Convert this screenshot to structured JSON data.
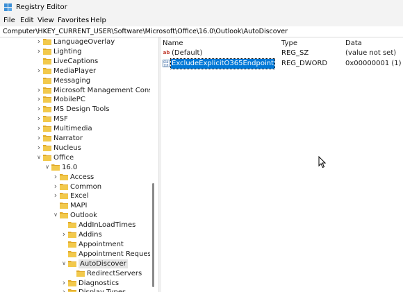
{
  "window": {
    "title": "Registry Editor"
  },
  "menu": {
    "items": [
      "File",
      "Edit",
      "View",
      "Favorites",
      "Help"
    ]
  },
  "address": {
    "path": "Computer\\HKEY_CURRENT_USER\\Software\\Microsoft\\Office\\16.0\\Outlook\\AutoDiscover"
  },
  "tree": {
    "items": [
      {
        "label": "LanguageOverlay",
        "level": 0,
        "expander": "collapsed"
      },
      {
        "label": "Lighting",
        "level": 0,
        "expander": "collapsed"
      },
      {
        "label": "LiveCaptions",
        "level": 0,
        "expander": "none"
      },
      {
        "label": "MediaPlayer",
        "level": 0,
        "expander": "collapsed"
      },
      {
        "label": "Messaging",
        "level": 0,
        "expander": "none"
      },
      {
        "label": "Microsoft Management Console",
        "level": 0,
        "expander": "collapsed"
      },
      {
        "label": "MobilePC",
        "level": 0,
        "expander": "collapsed"
      },
      {
        "label": "MS Design Tools",
        "level": 0,
        "expander": "collapsed"
      },
      {
        "label": "MSF",
        "level": 0,
        "expander": "collapsed"
      },
      {
        "label": "Multimedia",
        "level": 0,
        "expander": "collapsed"
      },
      {
        "label": "Narrator",
        "level": 0,
        "expander": "collapsed"
      },
      {
        "label": "Nucleus",
        "level": 0,
        "expander": "collapsed"
      },
      {
        "label": "Office",
        "level": 0,
        "expander": "expanded"
      },
      {
        "label": "16.0",
        "level": 1,
        "expander": "expanded"
      },
      {
        "label": "Access",
        "level": 2,
        "expander": "collapsed"
      },
      {
        "label": "Common",
        "level": 2,
        "expander": "collapsed"
      },
      {
        "label": "Excel",
        "level": 2,
        "expander": "collapsed"
      },
      {
        "label": "MAPI",
        "level": 2,
        "expander": "none"
      },
      {
        "label": "Outlook",
        "level": 2,
        "expander": "expanded"
      },
      {
        "label": "AddInLoadTimes",
        "level": 3,
        "expander": "none"
      },
      {
        "label": "Addins",
        "level": 3,
        "expander": "collapsed"
      },
      {
        "label": "Appointment",
        "level": 3,
        "expander": "none"
      },
      {
        "label": "Appointment Request",
        "level": 3,
        "expander": "none"
      },
      {
        "label": "AutoDiscover",
        "level": 3,
        "expander": "expanded",
        "selected": true
      },
      {
        "label": "RedirectServers",
        "level": 4,
        "expander": "none"
      },
      {
        "label": "Diagnostics",
        "level": 3,
        "expander": "collapsed"
      },
      {
        "label": "Display Types",
        "level": 3,
        "expander": "collapsed"
      }
    ]
  },
  "values": {
    "columns": {
      "name": "Name",
      "type": "Type",
      "data": "Data"
    },
    "rows": [
      {
        "icon": "ab-string-icon",
        "name": "(Default)",
        "type": "REG_SZ",
        "data": "(value not set)",
        "selected": false
      },
      {
        "icon": "binary-value-icon",
        "name": "ExcludeExplicitO365Endpoint",
        "type": "REG_DWORD",
        "data": "0x00000001 (1)",
        "selected": true
      }
    ]
  },
  "colors": {
    "folder": "#f2c94c",
    "selection": "#0078d7",
    "chrome": "#f3f3f3"
  }
}
